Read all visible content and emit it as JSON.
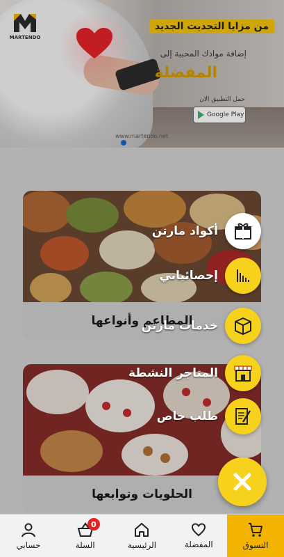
{
  "banner": {
    "logo_text": "MARTENDO",
    "promo_label": "من مزايا التحديث الجديد",
    "promo_line": "إضافة موادك المحببة إلى",
    "promo_title": "المفضلة",
    "promo_small": "حمل التطبيق الان",
    "store_label": "Google Play",
    "site": "www.martendo.net"
  },
  "cards": [
    {
      "caption": "المطاعم وأنواعها"
    },
    {
      "caption": "الحلويات وتوابعها"
    }
  ],
  "fab_menu": [
    {
      "label": "أكواد مارتن",
      "icon": "gift-icon"
    },
    {
      "label": "إحصائياتي",
      "icon": "stats-icon"
    },
    {
      "label": "خدمات مارتن",
      "icon": "box-icon"
    },
    {
      "label": "المتاجر النشطة",
      "icon": "store-icon"
    },
    {
      "label": "طلب خاص",
      "icon": "edit-document-icon"
    }
  ],
  "fab_close": {
    "icon": "close-icon"
  },
  "bottom_nav": [
    {
      "label": "التسوق",
      "icon": "cart-icon",
      "active": true
    },
    {
      "label": "المفضلة",
      "icon": "heart-icon",
      "active": false
    },
    {
      "label": "الرئيسية",
      "icon": "home-icon",
      "active": false
    },
    {
      "label": "السلة",
      "icon": "basket-icon",
      "active": false,
      "badge": "0"
    },
    {
      "label": "حسابي",
      "icon": "user-icon",
      "active": false
    }
  ],
  "colors": {
    "accent": "#f7d21d",
    "nav_active": "#f2b400",
    "badge": "#e02424"
  }
}
